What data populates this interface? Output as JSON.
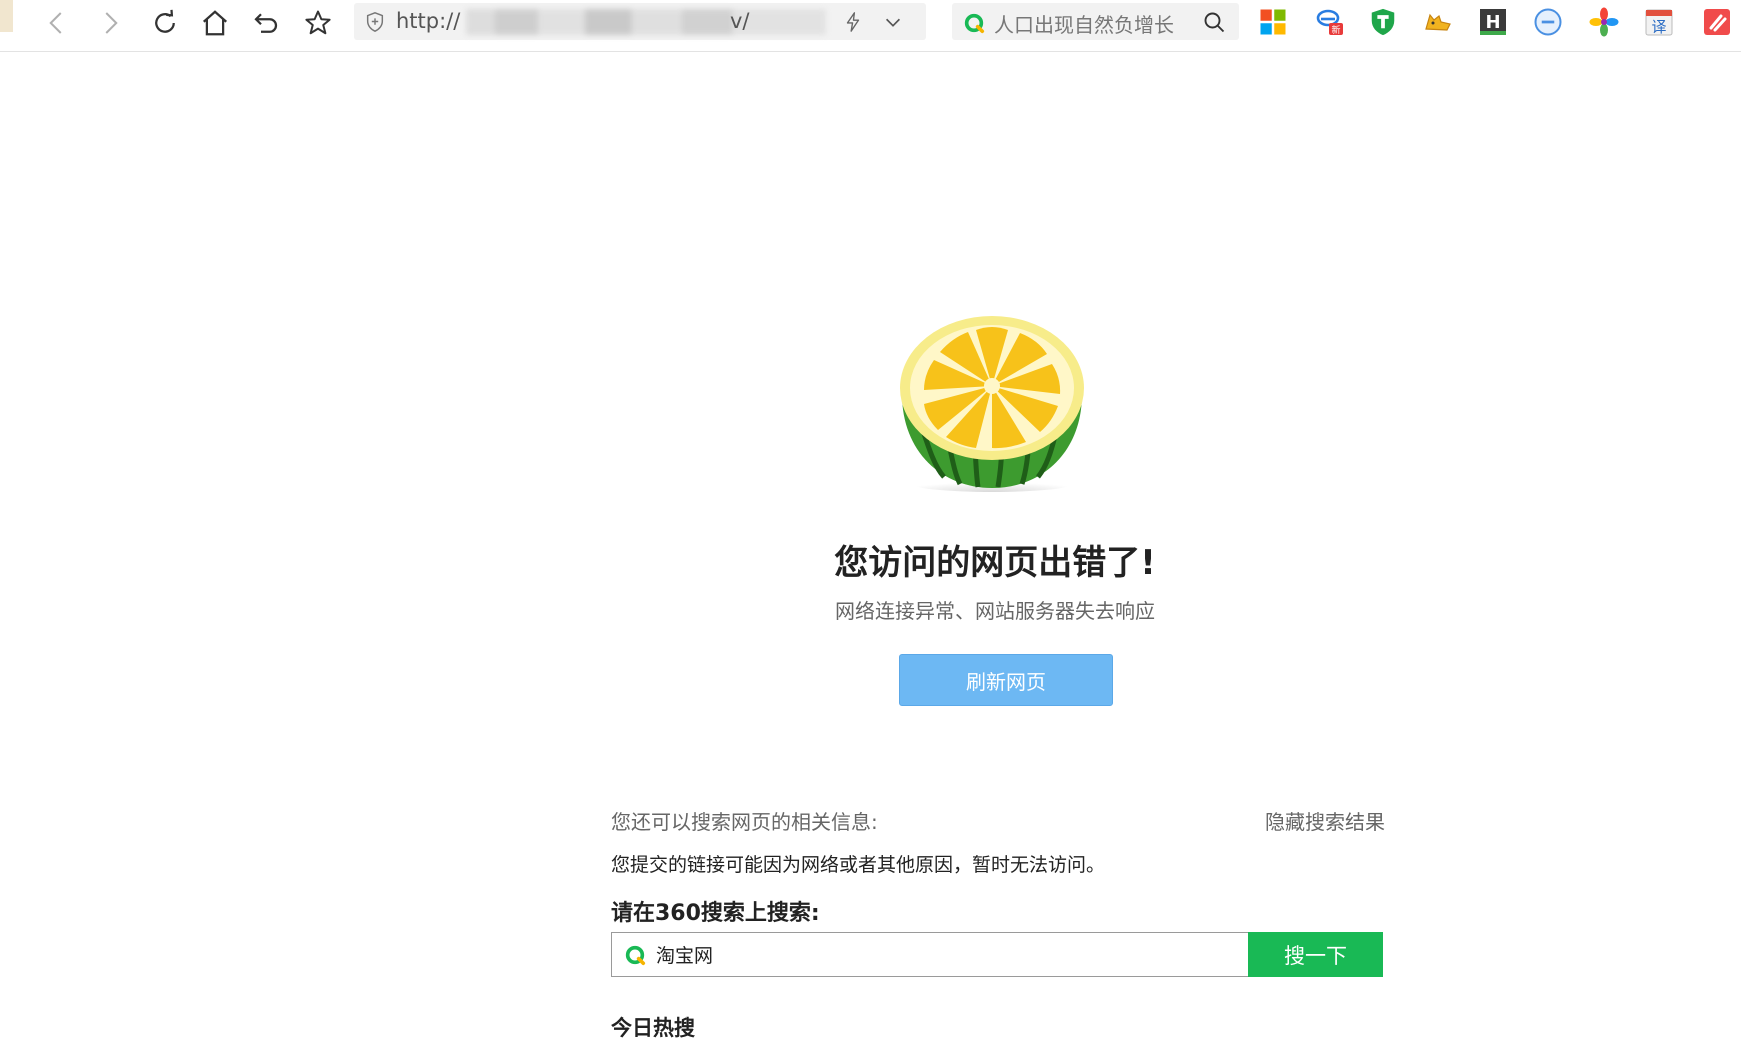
{
  "browser": {
    "url_prefix": "http://",
    "url_suffix": "v/",
    "search_query": "人口出现自然负增长"
  },
  "error": {
    "title": "您访问的网页出错了!",
    "subtitle": "网络连接异常、网站服务器失去响应",
    "refresh_label": "刷新网页"
  },
  "search_section": {
    "related_label": "您还可以搜索网页的相关信息:",
    "hide_label": "隐藏搜索结果",
    "reason_text": "您提交的链接可能因为网络或者其他原因，暂时无法访问。",
    "search_on_label": "请在360搜索上搜索:",
    "input_value": "淘宝网",
    "button_label": "搜一下",
    "hot_label": "今日热搜"
  },
  "extensions": {
    "news_badge": "新",
    "h_label": "H",
    "translate_label": "译"
  },
  "colors": {
    "refresh_button": "#6db8f3",
    "search_button": "#19b955"
  }
}
